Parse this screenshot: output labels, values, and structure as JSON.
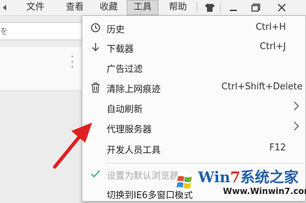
{
  "menubar": {
    "items": [
      {
        "label": "文件"
      },
      {
        "label": "查看"
      },
      {
        "label": "收藏"
      },
      {
        "label": "工具"
      },
      {
        "label": "帮助"
      }
    ],
    "address_fragment": "を"
  },
  "dropdown": {
    "items": [
      {
        "label": "历史",
        "shortcut": "Ctrl+H",
        "icon": "history-icon"
      },
      {
        "label": "下载器",
        "shortcut": "Ctrl+J",
        "icon": "download-icon"
      },
      {
        "label": "广告过滤",
        "shortcut": "",
        "icon": ""
      },
      {
        "label": "清除上网痕迹",
        "shortcut": "Ctrl+Shift+Delete",
        "icon": "trash-icon"
      },
      {
        "label": "自动刷新",
        "shortcut": "",
        "icon": "",
        "submenu": true
      },
      {
        "label": "代理服务器",
        "shortcut": "",
        "icon": "",
        "submenu": true
      },
      {
        "label": "开发人员工具",
        "shortcut": "F12",
        "icon": ""
      },
      {
        "label": "设置为默认浏览器",
        "shortcut": "",
        "icon": "check-icon",
        "disabled": true
      },
      {
        "label": "切换到IE6多窗口模式",
        "shortcut": "",
        "icon": ""
      }
    ]
  },
  "watermark": {
    "brand_prefix": "Win",
    "brand_seven": "7",
    "brand_suffix": "系统之家",
    "url": "Www.Winwin7.com"
  },
  "colors": {
    "accent_red": "#e02020",
    "check_green": "#3cb878",
    "brand_blue": "#1f5fa8"
  }
}
